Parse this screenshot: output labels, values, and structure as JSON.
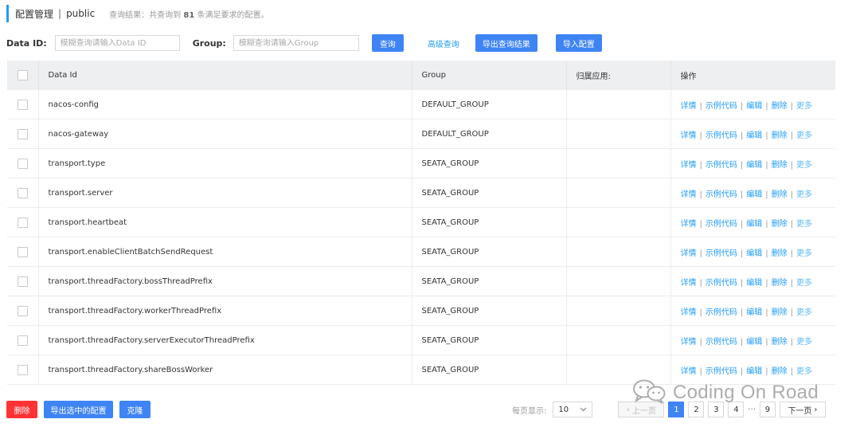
{
  "header": {
    "title": "配置管理",
    "separator": "|",
    "namespace": "public",
    "result_prefix": "查询结果：共查询到",
    "result_count": "81",
    "result_suffix": "条满足要求的配置。"
  },
  "filters": {
    "data_id_label": "Data ID:",
    "data_id_placeholder": "模糊查询请输入Data ID",
    "group_label": "Group:",
    "group_placeholder": "模糊查询请输入Group",
    "search_label": "查询",
    "advanced_label": "高级查询",
    "export_results_label": "导出查询结果",
    "import_label": "导入配置"
  },
  "table": {
    "headers": [
      "Data Id",
      "Group",
      "归属应用:",
      "操作"
    ],
    "ops": [
      "详情",
      "示例代码",
      "编辑",
      "删除",
      "更多"
    ],
    "rows": [
      {
        "data_id": "nacos-config",
        "group": "DEFAULT_GROUP",
        "app": ""
      },
      {
        "data_id": "nacos-gateway",
        "group": "DEFAULT_GROUP",
        "app": ""
      },
      {
        "data_id": "transport.type",
        "group": "SEATA_GROUP",
        "app": ""
      },
      {
        "data_id": "transport.server",
        "group": "SEATA_GROUP",
        "app": ""
      },
      {
        "data_id": "transport.heartbeat",
        "group": "SEATA_GROUP",
        "app": ""
      },
      {
        "data_id": "transport.enableClientBatchSendRequest",
        "group": "SEATA_GROUP",
        "app": ""
      },
      {
        "data_id": "transport.threadFactory.bossThreadPrefix",
        "group": "SEATA_GROUP",
        "app": ""
      },
      {
        "data_id": "transport.threadFactory.workerThreadPrefix",
        "group": "SEATA_GROUP",
        "app": ""
      },
      {
        "data_id": "transport.threadFactory.serverExecutorThreadPrefix",
        "group": "SEATA_GROUP",
        "app": ""
      },
      {
        "data_id": "transport.threadFactory.shareBossWorker",
        "group": "SEATA_GROUP",
        "app": ""
      }
    ]
  },
  "bottom": {
    "delete_label": "删除",
    "export_selected_label": "导出选中的配置",
    "clone_label": "克隆"
  },
  "pagination": {
    "per_page_label": "每页显示:",
    "per_page_value": "10",
    "prev_label": "上一页",
    "pages": [
      "1",
      "2",
      "3",
      "4"
    ],
    "ellipsis": "···",
    "last_page": "9",
    "next_label": "下一页",
    "current_page": "1"
  },
  "watermark": {
    "text": "Coding On Road"
  },
  "colors": {
    "primary": "#3f84f5",
    "link": "#209bfa",
    "danger": "#ff3333",
    "header_bg": "#eeeff1"
  }
}
